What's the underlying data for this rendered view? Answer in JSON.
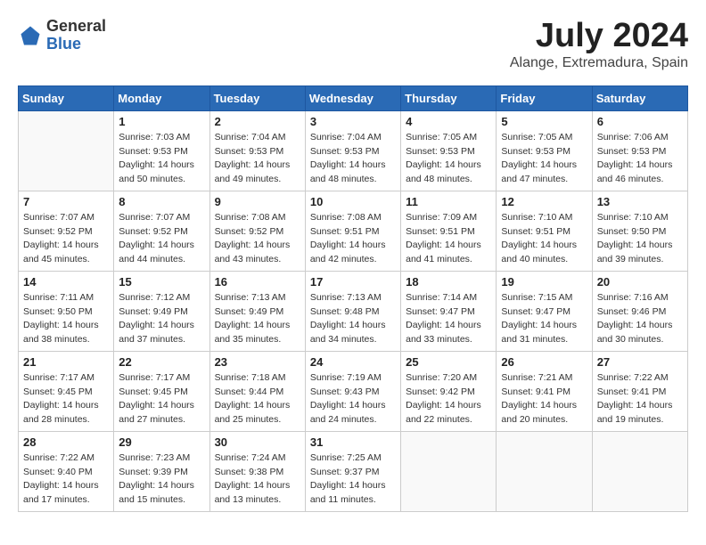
{
  "header": {
    "logo_general": "General",
    "logo_blue": "Blue",
    "title": "July 2024",
    "location": "Alange, Extremadura, Spain"
  },
  "weekdays": [
    "Sunday",
    "Monday",
    "Tuesday",
    "Wednesday",
    "Thursday",
    "Friday",
    "Saturday"
  ],
  "weeks": [
    [
      {
        "day": "",
        "sunrise": "",
        "sunset": "",
        "daylight": ""
      },
      {
        "day": "1",
        "sunrise": "Sunrise: 7:03 AM",
        "sunset": "Sunset: 9:53 PM",
        "daylight": "Daylight: 14 hours and 50 minutes."
      },
      {
        "day": "2",
        "sunrise": "Sunrise: 7:04 AM",
        "sunset": "Sunset: 9:53 PM",
        "daylight": "Daylight: 14 hours and 49 minutes."
      },
      {
        "day": "3",
        "sunrise": "Sunrise: 7:04 AM",
        "sunset": "Sunset: 9:53 PM",
        "daylight": "Daylight: 14 hours and 48 minutes."
      },
      {
        "day": "4",
        "sunrise": "Sunrise: 7:05 AM",
        "sunset": "Sunset: 9:53 PM",
        "daylight": "Daylight: 14 hours and 48 minutes."
      },
      {
        "day": "5",
        "sunrise": "Sunrise: 7:05 AM",
        "sunset": "Sunset: 9:53 PM",
        "daylight": "Daylight: 14 hours and 47 minutes."
      },
      {
        "day": "6",
        "sunrise": "Sunrise: 7:06 AM",
        "sunset": "Sunset: 9:53 PM",
        "daylight": "Daylight: 14 hours and 46 minutes."
      }
    ],
    [
      {
        "day": "7",
        "sunrise": "Sunrise: 7:07 AM",
        "sunset": "Sunset: 9:52 PM",
        "daylight": "Daylight: 14 hours and 45 minutes."
      },
      {
        "day": "8",
        "sunrise": "Sunrise: 7:07 AM",
        "sunset": "Sunset: 9:52 PM",
        "daylight": "Daylight: 14 hours and 44 minutes."
      },
      {
        "day": "9",
        "sunrise": "Sunrise: 7:08 AM",
        "sunset": "Sunset: 9:52 PM",
        "daylight": "Daylight: 14 hours and 43 minutes."
      },
      {
        "day": "10",
        "sunrise": "Sunrise: 7:08 AM",
        "sunset": "Sunset: 9:51 PM",
        "daylight": "Daylight: 14 hours and 42 minutes."
      },
      {
        "day": "11",
        "sunrise": "Sunrise: 7:09 AM",
        "sunset": "Sunset: 9:51 PM",
        "daylight": "Daylight: 14 hours and 41 minutes."
      },
      {
        "day": "12",
        "sunrise": "Sunrise: 7:10 AM",
        "sunset": "Sunset: 9:51 PM",
        "daylight": "Daylight: 14 hours and 40 minutes."
      },
      {
        "day": "13",
        "sunrise": "Sunrise: 7:10 AM",
        "sunset": "Sunset: 9:50 PM",
        "daylight": "Daylight: 14 hours and 39 minutes."
      }
    ],
    [
      {
        "day": "14",
        "sunrise": "Sunrise: 7:11 AM",
        "sunset": "Sunset: 9:50 PM",
        "daylight": "Daylight: 14 hours and 38 minutes."
      },
      {
        "day": "15",
        "sunrise": "Sunrise: 7:12 AM",
        "sunset": "Sunset: 9:49 PM",
        "daylight": "Daylight: 14 hours and 37 minutes."
      },
      {
        "day": "16",
        "sunrise": "Sunrise: 7:13 AM",
        "sunset": "Sunset: 9:49 PM",
        "daylight": "Daylight: 14 hours and 35 minutes."
      },
      {
        "day": "17",
        "sunrise": "Sunrise: 7:13 AM",
        "sunset": "Sunset: 9:48 PM",
        "daylight": "Daylight: 14 hours and 34 minutes."
      },
      {
        "day": "18",
        "sunrise": "Sunrise: 7:14 AM",
        "sunset": "Sunset: 9:47 PM",
        "daylight": "Daylight: 14 hours and 33 minutes."
      },
      {
        "day": "19",
        "sunrise": "Sunrise: 7:15 AM",
        "sunset": "Sunset: 9:47 PM",
        "daylight": "Daylight: 14 hours and 31 minutes."
      },
      {
        "day": "20",
        "sunrise": "Sunrise: 7:16 AM",
        "sunset": "Sunset: 9:46 PM",
        "daylight": "Daylight: 14 hours and 30 minutes."
      }
    ],
    [
      {
        "day": "21",
        "sunrise": "Sunrise: 7:17 AM",
        "sunset": "Sunset: 9:45 PM",
        "daylight": "Daylight: 14 hours and 28 minutes."
      },
      {
        "day": "22",
        "sunrise": "Sunrise: 7:17 AM",
        "sunset": "Sunset: 9:45 PM",
        "daylight": "Daylight: 14 hours and 27 minutes."
      },
      {
        "day": "23",
        "sunrise": "Sunrise: 7:18 AM",
        "sunset": "Sunset: 9:44 PM",
        "daylight": "Daylight: 14 hours and 25 minutes."
      },
      {
        "day": "24",
        "sunrise": "Sunrise: 7:19 AM",
        "sunset": "Sunset: 9:43 PM",
        "daylight": "Daylight: 14 hours and 24 minutes."
      },
      {
        "day": "25",
        "sunrise": "Sunrise: 7:20 AM",
        "sunset": "Sunset: 9:42 PM",
        "daylight": "Daylight: 14 hours and 22 minutes."
      },
      {
        "day": "26",
        "sunrise": "Sunrise: 7:21 AM",
        "sunset": "Sunset: 9:41 PM",
        "daylight": "Daylight: 14 hours and 20 minutes."
      },
      {
        "day": "27",
        "sunrise": "Sunrise: 7:22 AM",
        "sunset": "Sunset: 9:41 PM",
        "daylight": "Daylight: 14 hours and 19 minutes."
      }
    ],
    [
      {
        "day": "28",
        "sunrise": "Sunrise: 7:22 AM",
        "sunset": "Sunset: 9:40 PM",
        "daylight": "Daylight: 14 hours and 17 minutes."
      },
      {
        "day": "29",
        "sunrise": "Sunrise: 7:23 AM",
        "sunset": "Sunset: 9:39 PM",
        "daylight": "Daylight: 14 hours and 15 minutes."
      },
      {
        "day": "30",
        "sunrise": "Sunrise: 7:24 AM",
        "sunset": "Sunset: 9:38 PM",
        "daylight": "Daylight: 14 hours and 13 minutes."
      },
      {
        "day": "31",
        "sunrise": "Sunrise: 7:25 AM",
        "sunset": "Sunset: 9:37 PM",
        "daylight": "Daylight: 14 hours and 11 minutes."
      },
      {
        "day": "",
        "sunrise": "",
        "sunset": "",
        "daylight": ""
      },
      {
        "day": "",
        "sunrise": "",
        "sunset": "",
        "daylight": ""
      },
      {
        "day": "",
        "sunrise": "",
        "sunset": "",
        "daylight": ""
      }
    ]
  ]
}
